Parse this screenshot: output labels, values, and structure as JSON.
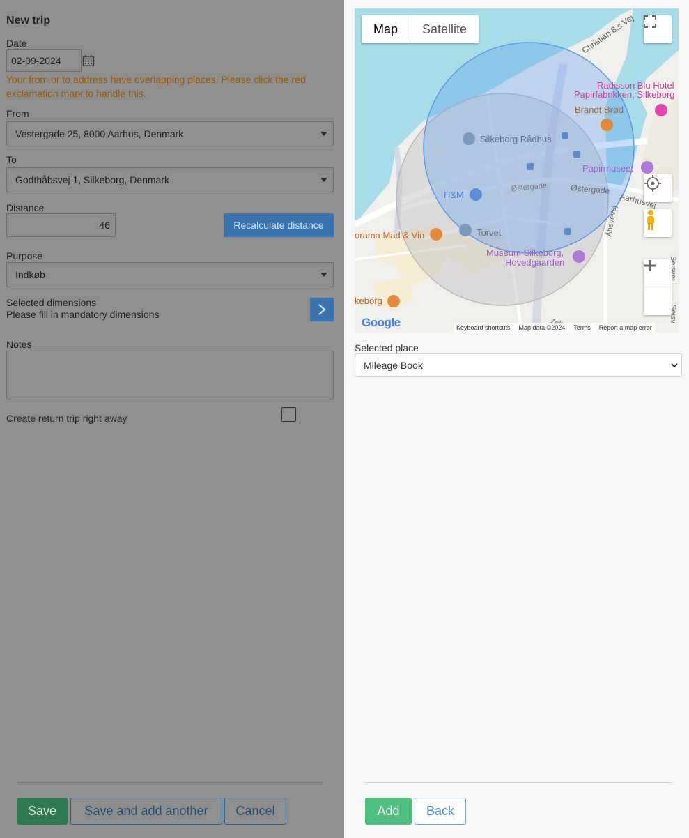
{
  "form": {
    "title": "New trip",
    "date_label": "Date",
    "date_value": "02-09-2024",
    "warning": "Your from or to address have overlapping places. Please click the red exclamation mark to handle this.",
    "from_label": "From",
    "from_value": "Vestergade 25, 8000 Aarhus, Denmark",
    "to_label": "To",
    "to_value": "Godthåbsvej 1, Silkeborg, Denmark",
    "distance_label": "Distance",
    "distance_value": "46",
    "recalc_label": "Recalculate distance",
    "purpose_label": "Purpose",
    "purpose_value": "Indkøb",
    "dimensions_label": "Selected dimensions",
    "dimensions_hint": "Please fill in mandatory dimensions",
    "notes_label": "Notes",
    "notes_value": "",
    "return_label": "Create return trip right away"
  },
  "footer": {
    "save_label": "Save",
    "save_add_label": "Save and add another",
    "cancel_label": "Cancel"
  },
  "map": {
    "type_map": "Map",
    "type_satellite": "Satellite",
    "places": {
      "christian": "Christian 8.s Vej",
      "radisson": "Radisson Blu Hotel",
      "papirfabrikken": "Papirfabrikken, Silkeborg",
      "brandt": "Brandt Brød",
      "radhus": "Silkeborg Rådhus",
      "papirmuseet": "Papirmuseet",
      "hm": "H&M",
      "ostergade1": "Østergade",
      "ostergade2": "Østergade",
      "aarhusvej": "Aarhusvej",
      "ahavevej": "Åhavevej",
      "seisvej": "Seisvej",
      "torvet": "Torvet",
      "panorama": "orama Mad & Vin",
      "museum1": "Museum Silkeborg,",
      "museum2": "Hovedgaarden",
      "keborg": "keborg",
      "zelt": "Zelt",
      "seisv2": "Seisv"
    },
    "google": "Google",
    "keyboard": "Keyboard shortcuts",
    "mapdata": "Map data ©2024",
    "terms": "Terms",
    "report": "Report a map error"
  },
  "panel": {
    "selected_place_label": "Selected place",
    "selected_place_value": "Mileage Book",
    "add_label": "Add",
    "back_label": "Back"
  },
  "colors": {
    "save_green": "#2e8b57",
    "add_green": "#4fbf7f",
    "link_blue": "#2a6fb5",
    "warning_orange": "#9b5a00",
    "circle_blue": "#4a90e2"
  }
}
